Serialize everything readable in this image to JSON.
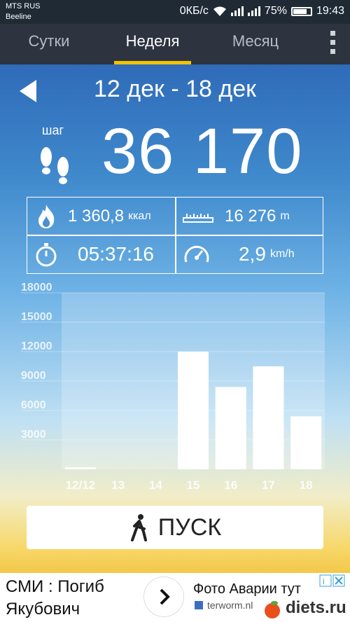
{
  "status_bar": {
    "carrier1": "MTS RUS",
    "carrier2": "Beeline",
    "speed": "0КБ/с",
    "battery": "75%",
    "time": "19:43"
  },
  "tabs": [
    {
      "label": "Сутки",
      "active": false
    },
    {
      "label": "Неделя",
      "active": true
    },
    {
      "label": "Месяц",
      "active": false
    }
  ],
  "period": {
    "range": "12 дек - 18 дек"
  },
  "steps": {
    "label": "шаг",
    "value": "36 170"
  },
  "stats": {
    "calories": {
      "value": "1 360,8",
      "unit": "ккал"
    },
    "distance": {
      "value": "16 276",
      "unit": "m"
    },
    "duration": {
      "value": "05:37:16"
    },
    "speed": {
      "value": "2,9",
      "unit": "km/h"
    }
  },
  "chart_data": {
    "type": "bar",
    "categories": [
      "12/12",
      "13",
      "14",
      "15",
      "16",
      "17",
      "18"
    ],
    "values": [
      200,
      0,
      0,
      12000,
      8400,
      10500,
      5400
    ],
    "y_ticks": [
      3000,
      6000,
      9000,
      12000,
      15000,
      18000
    ],
    "ylim": [
      0,
      18000
    ],
    "grid": true
  },
  "start_button": {
    "label": "ПУСК"
  },
  "ad": {
    "left_text": "СМИ : Погиб Якубович",
    "right_title": "Фото Аварии тут",
    "right_domain": "terworm.nl",
    "logo": "diets.ru"
  },
  "colors": {
    "accent": "#f3c200",
    "tab_bg": "#2d3440",
    "statusbar_bg": "#1f2a35"
  }
}
